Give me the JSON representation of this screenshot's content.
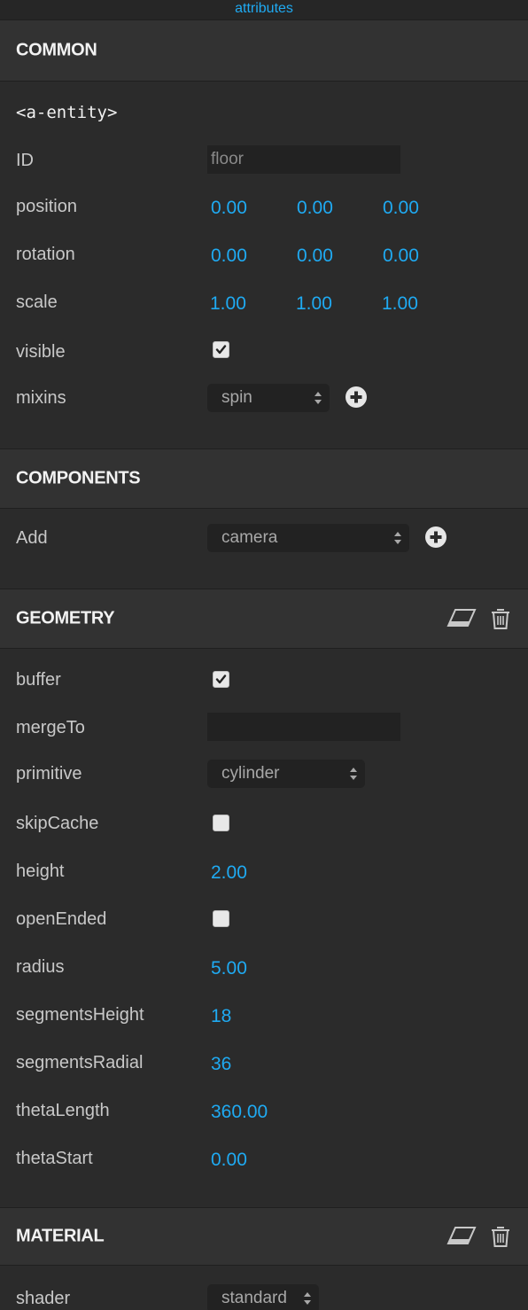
{
  "tab": {
    "label": "attributes"
  },
  "common": {
    "title": "COMMON",
    "tag": "<a-entity>",
    "id": {
      "label": "ID",
      "value": "floor"
    },
    "position": {
      "label": "position",
      "x": "0.00",
      "y": "0.00",
      "z": "0.00"
    },
    "rotation": {
      "label": "rotation",
      "x": "0.00",
      "y": "0.00",
      "z": "0.00"
    },
    "scale": {
      "label": "scale",
      "x": "1.00",
      "y": "1.00",
      "z": "1.00"
    },
    "visible": {
      "label": "visible",
      "checked": true
    },
    "mixins": {
      "label": "mixins",
      "selected": "spin"
    }
  },
  "components": {
    "title": "COMPONENTS",
    "add": {
      "label": "Add",
      "selected": "camera"
    }
  },
  "geometry": {
    "title": "GEOMETRY",
    "buffer": {
      "label": "buffer",
      "checked": true
    },
    "mergeTo": {
      "label": "mergeTo",
      "value": ""
    },
    "primitive": {
      "label": "primitive",
      "selected": "cylinder"
    },
    "skipCache": {
      "label": "skipCache",
      "checked": false
    },
    "height": {
      "label": "height",
      "value": "2.00"
    },
    "openEnded": {
      "label": "openEnded",
      "checked": false
    },
    "radius": {
      "label": "radius",
      "value": "5.00"
    },
    "segmentsHeight": {
      "label": "segmentsHeight",
      "value": "18"
    },
    "segmentsRadial": {
      "label": "segmentsRadial",
      "value": "36"
    },
    "thetaLength": {
      "label": "thetaLength",
      "value": "360.00"
    },
    "thetaStart": {
      "label": "thetaStart",
      "value": "0.00"
    }
  },
  "material": {
    "title": "MATERIAL",
    "shader": {
      "label": "shader",
      "selected": "standard"
    }
  },
  "colors": {
    "accent": "#1faaf2",
    "background": "#2b2b2b",
    "header": "#323232",
    "input": "#222222"
  },
  "icons": {
    "plus": "plus-circle-icon",
    "eraser": "eraser-icon",
    "trash": "trash-icon",
    "check": "checkmark-icon",
    "updown": "updown-arrows-icon"
  }
}
